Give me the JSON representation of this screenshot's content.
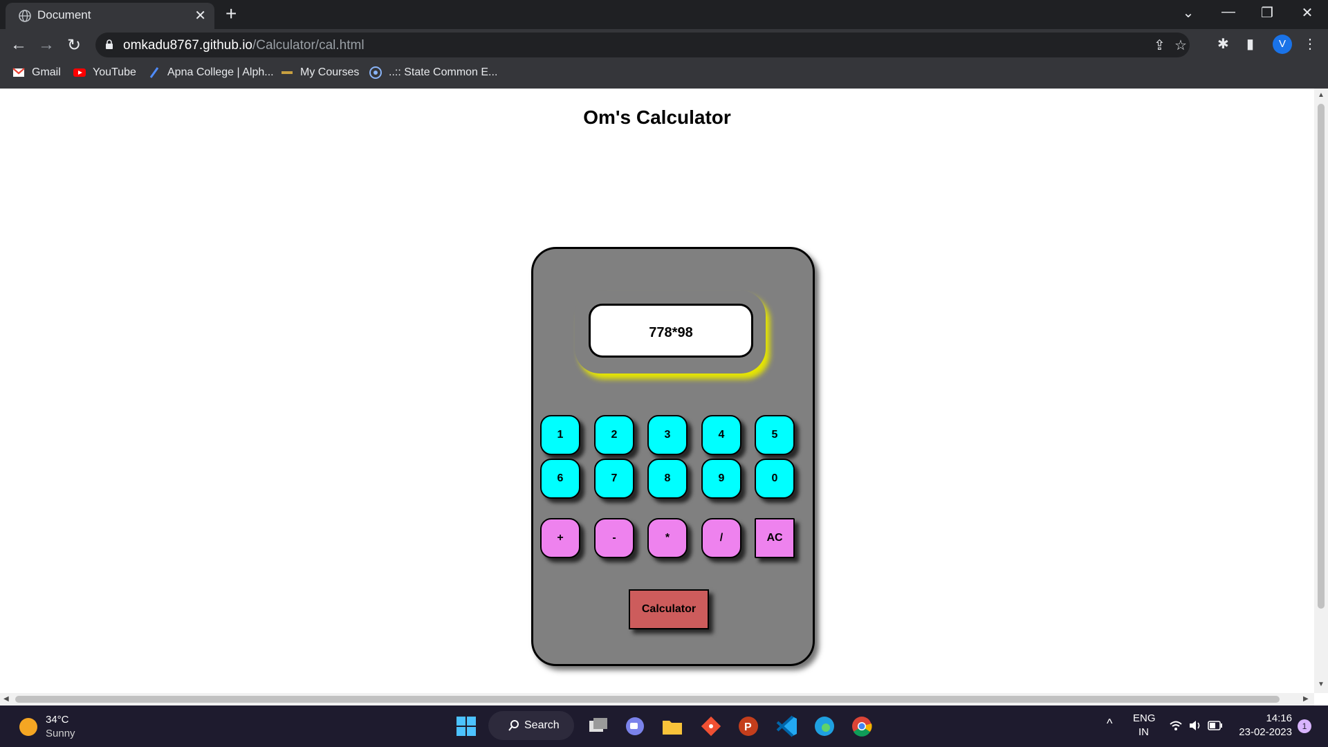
{
  "tab": {
    "title": "Document",
    "close": "✕",
    "new_tab": "+"
  },
  "window": {
    "dropdown": "⌄",
    "minimize": "—",
    "restore": "❐",
    "close": "✕"
  },
  "nav": {
    "back": "←",
    "forward": "→",
    "reload": "↻"
  },
  "address": {
    "host": "omkadu8767.github.io",
    "path": "/Calculator/cal.html"
  },
  "toolbar_icons": {
    "share": "⇪",
    "star": "☆",
    "extensions": "✱",
    "sidepanel": "▮",
    "profile": "V",
    "menu": "⋮"
  },
  "bookmarks": [
    {
      "label": "Gmail"
    },
    {
      "label": "YouTube"
    },
    {
      "label": "Apna College | Alph..."
    },
    {
      "label": "My Courses"
    },
    {
      "label": "..:: State Common E..."
    }
  ],
  "page": {
    "title": "Om's Calculator"
  },
  "calculator": {
    "display": "778*98",
    "number_keys": [
      "1",
      "2",
      "3",
      "4",
      "5",
      "6",
      "7",
      "8",
      "9",
      "0"
    ],
    "operator_keys": [
      "+",
      "-",
      "*",
      "/"
    ],
    "clear_key": "AC",
    "evaluate_button": "Calculator",
    "colors": {
      "body": "#808080",
      "number": "#00ffff",
      "operator": "#ee82ee",
      "evaluate": "#cd5c5c",
      "glow": "#e6e600"
    }
  },
  "taskbar": {
    "weather": {
      "temp": "34°C",
      "desc": "Sunny"
    },
    "search": "Search",
    "tray": {
      "lang": "ENG",
      "region": "IN",
      "up": "^"
    },
    "clock": {
      "time": "14:16",
      "date": "23-02-2023"
    },
    "notifications": "1"
  }
}
